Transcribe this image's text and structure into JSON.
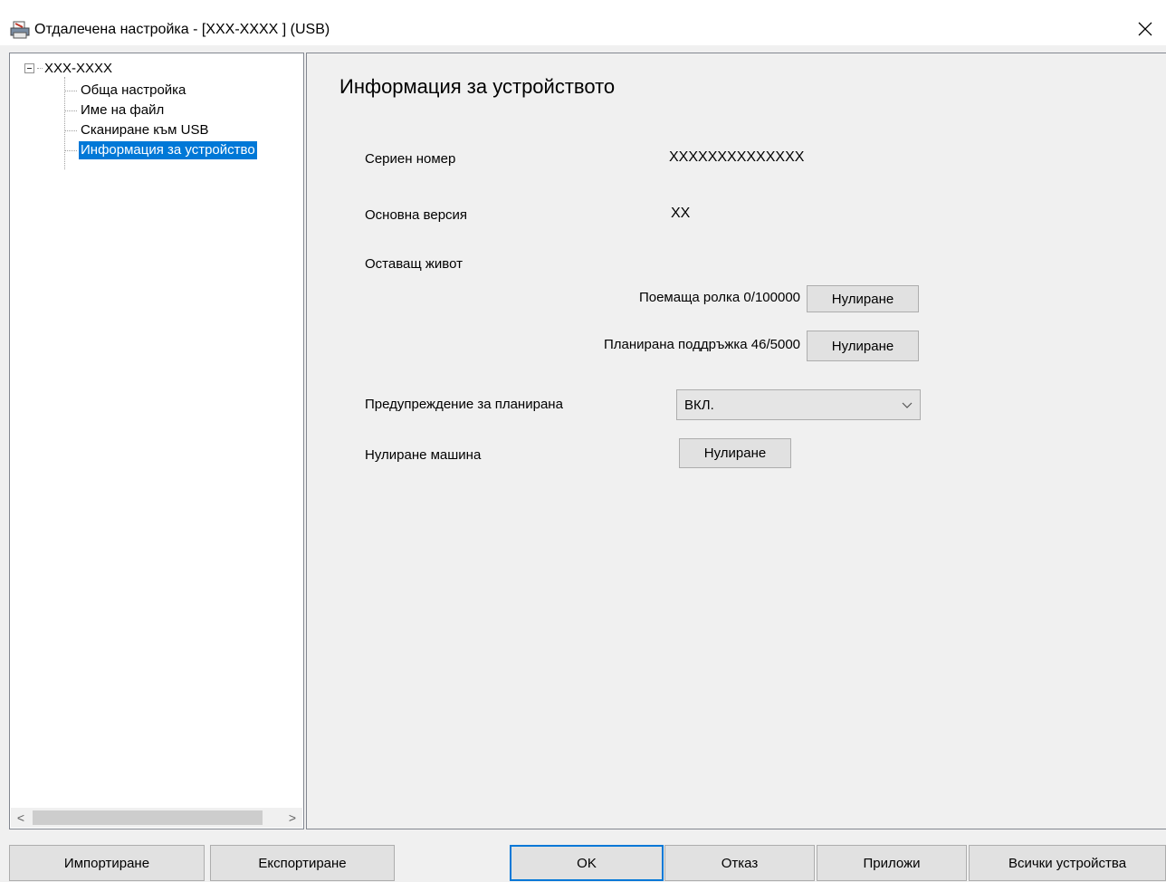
{
  "window": {
    "title": "Отдалечена настройка - [XXX-XXXX ] (USB)",
    "close_glyph": "✕"
  },
  "tree": {
    "root_label": "XXX-XXXX",
    "items": [
      {
        "label": "Обща настройка",
        "selected": false
      },
      {
        "label": "Име на файл",
        "selected": false
      },
      {
        "label": "Сканиране към USB",
        "selected": false
      },
      {
        "label": "Информация за устройство",
        "selected": true
      }
    ],
    "scroll_left": "<",
    "scroll_right": ">"
  },
  "content": {
    "title": "Информация за устройството",
    "serial_label": "Сериен номер",
    "serial_value": "XXXXXXXXXXXXXX",
    "firmware_label": "Основна версия",
    "firmware_value": "XX",
    "remaining_life_label": "Оставащ живот",
    "pickup_roller_label": "Поемаща ролка 0/100000",
    "pickup_roller_reset": "Нулиране",
    "maintenance_label": "Планирана поддръжка 46/5000",
    "maintenance_reset": "Нулиране",
    "warning_label": "Предупреждение за планирана",
    "warning_value": "ВКЛ.",
    "machine_reset_label": "Нулиране машина",
    "machine_reset_button": "Нулиране"
  },
  "footer": {
    "import": "Импортиране",
    "export": "Експортиране",
    "ok": "OK",
    "cancel": "Отказ",
    "apply": "Приложи",
    "all_devices": "Всички устройства"
  },
  "colors": {
    "selection": "#0078d7",
    "panel_bg": "#f0f0f0",
    "tree_bg": "#ffffff"
  }
}
